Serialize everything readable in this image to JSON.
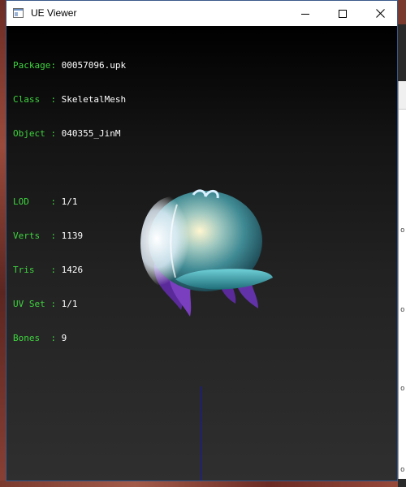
{
  "window": {
    "title": "UE Viewer"
  },
  "info": {
    "rows": [
      {
        "label": "Package: ",
        "value": "00057096.upk"
      },
      {
        "label": "Class  : ",
        "value": "SkeletalMesh"
      },
      {
        "label": "Object : ",
        "value": "040355_JinM"
      }
    ],
    "stats": [
      {
        "label": "LOD    : ",
        "value": "1/1"
      },
      {
        "label": "Verts  : ",
        "value": "1139"
      },
      {
        "label": "Tris   : ",
        "value": "1426"
      },
      {
        "label": "UV Set : ",
        "value": "1/1"
      },
      {
        "label": "Bones  : ",
        "value": "9"
      }
    ]
  },
  "colors": {
    "label_green": "#3fd43f",
    "value_white": "#ffffff",
    "axis_blue": "#1414b4"
  },
  "icons": {
    "app": "window-icon",
    "minimize": "minimize-icon",
    "maximize": "maximize-icon",
    "close": "close-icon"
  }
}
